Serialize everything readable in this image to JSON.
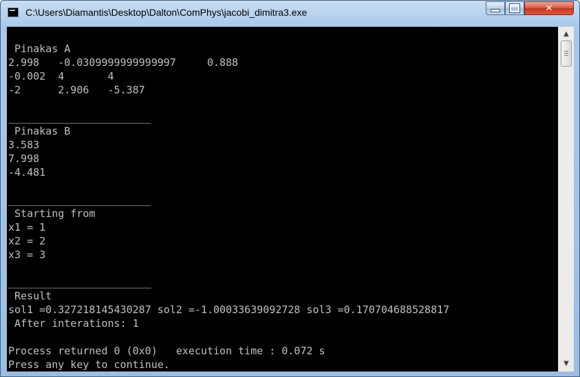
{
  "window": {
    "title": "C:\\Users\\Diamantis\\Desktop\\Dalton\\ComPhys\\jacobi_dimitra3.exe",
    "minimize_icon": "minimize-icon",
    "maximize_icon": "maximize-icon",
    "close_glyph": "✕"
  },
  "console": {
    "text": "\n Pinakas A\n2.998   -0.0309999999999997     0.888\n-0.002  4       4\n-2      2.906   -5.387\n\n_______________________\n Pinakas B\n3.583\n7.998\n-4.481\n\n_______________________\n Starting from\nx1 = 1\nx2 = 2\nx3 = 3\n\n_______________________\n Result\nsol1 =0.327218145430287 sol2 =-1.00033639092728 sol3 =0.170704688528817\n After interations: 1\n\nProcess returned 0 (0x0)   execution time : 0.072 s\nPress any key to continue."
  },
  "scrollbar": {
    "up_glyph": "▲",
    "down_glyph": "▼"
  },
  "colors": {
    "console_bg": "#000000",
    "console_fg": "#c0c0c0",
    "close_button": "#c4341e"
  }
}
